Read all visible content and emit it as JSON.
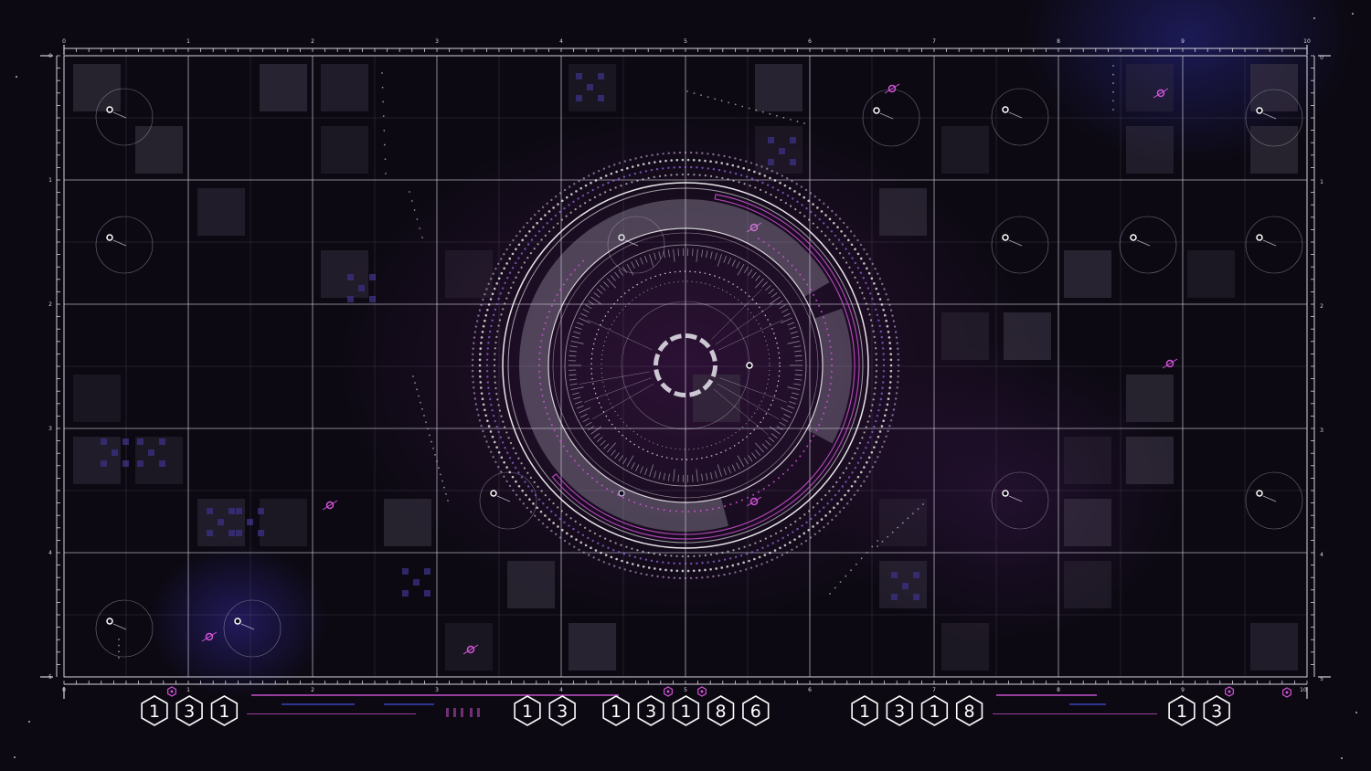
{
  "hud": {
    "scale_labels_x": [
      "0",
      "1",
      "2",
      "3",
      "4",
      "5",
      "6",
      "7",
      "8",
      "9",
      "10"
    ],
    "scale_labels_y": [
      "0",
      "1",
      "2",
      "3",
      "4",
      "5"
    ],
    "digit_groups": [
      {
        "digits": [
          "1",
          "3",
          "1"
        ]
      },
      {
        "digits": [
          "1",
          "3"
        ]
      },
      {
        "digits": [
          "1",
          "3",
          "1",
          "8",
          "6"
        ]
      },
      {
        "digits": [
          "1",
          "3",
          "1",
          "8"
        ]
      },
      {
        "digits": [
          "1",
          "3"
        ]
      }
    ]
  },
  "colors": {
    "grid_line": "#d6d3e0",
    "accent_pink": "#d354d8",
    "accent_purple": "#9a6cf0",
    "accent_blue": "#3c48c8",
    "tile_fill": "#3c3646",
    "background": "#0c0912"
  }
}
